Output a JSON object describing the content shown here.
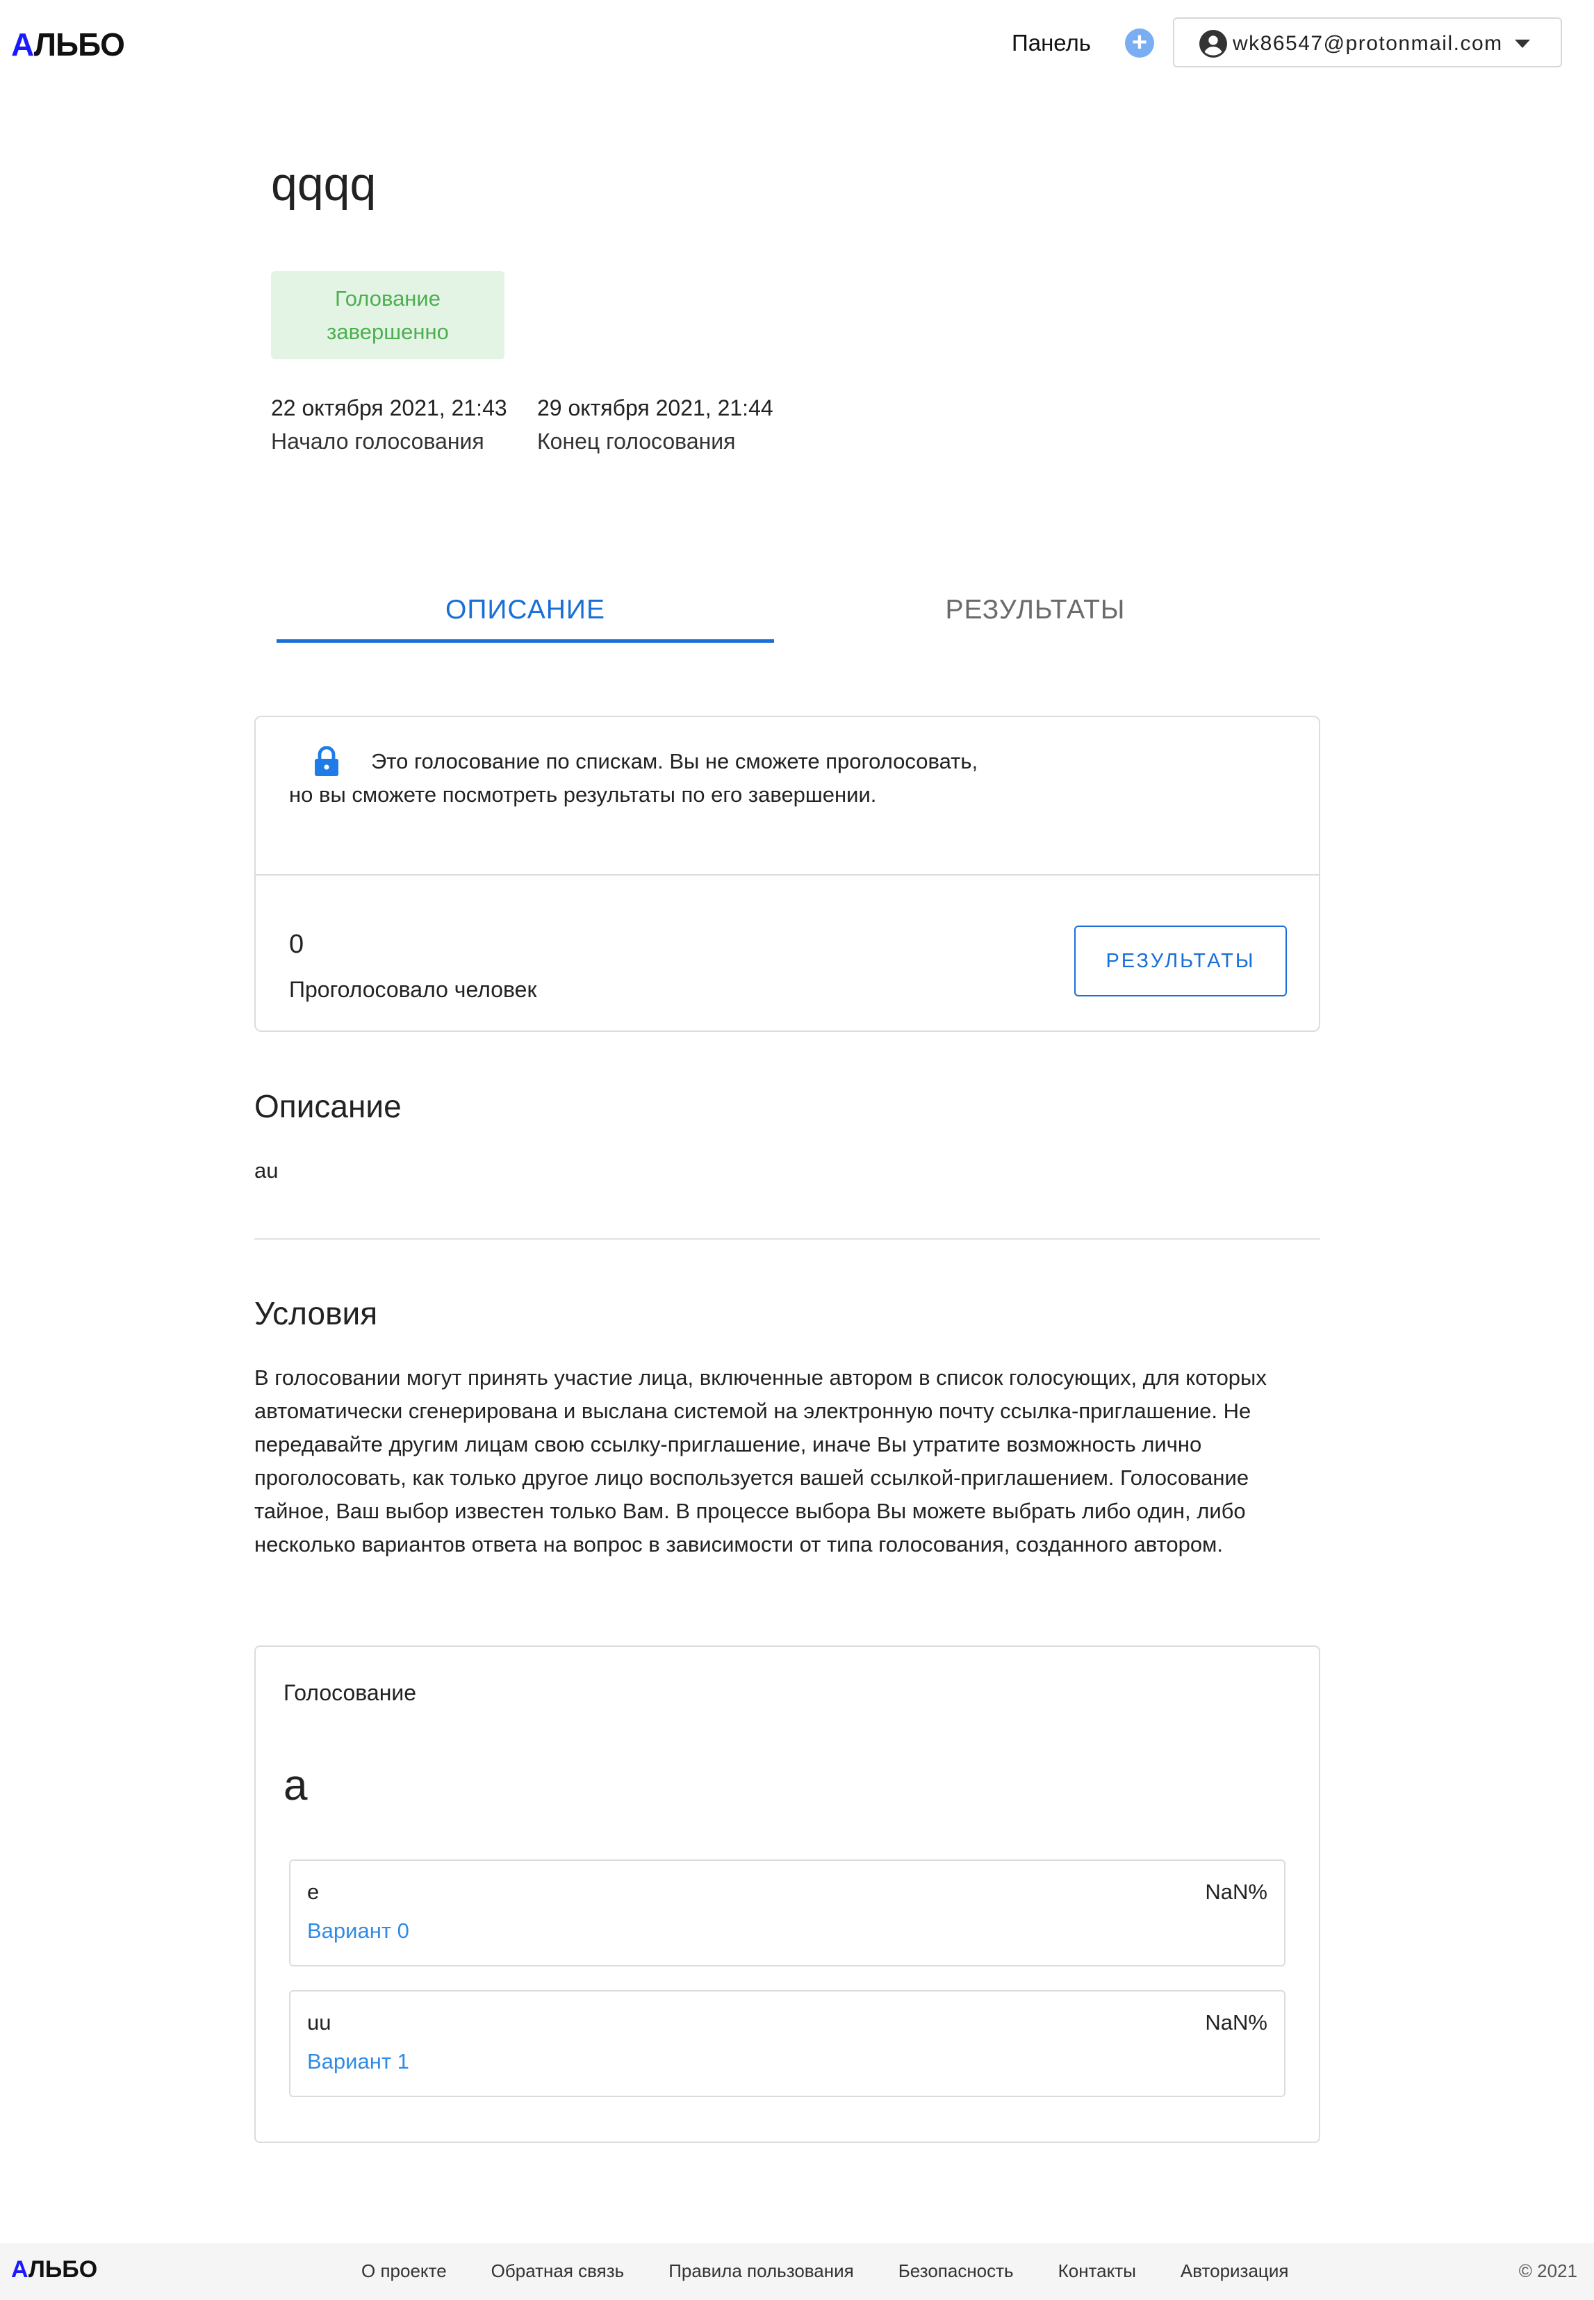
{
  "header": {
    "logo": {
      "first": "А",
      "rest": "ЛЬБО"
    },
    "nav_panel": "Панель",
    "add_icon": "plus-circle-icon",
    "user_email": "wk86547@protonmail.com",
    "user_icon": "account-circle-icon"
  },
  "poll": {
    "title": "qqqq",
    "status": "Голование завершенно",
    "start": {
      "value": "22 октября 2021, 21:43",
      "label": "Начало голосования"
    },
    "end": {
      "value": "29 октября 2021, 21:44",
      "label": "Конец голосования"
    }
  },
  "tabs": [
    {
      "label": "ОПИСАНИЕ",
      "active": true
    },
    {
      "label": "РЕЗУЛЬТАТЫ",
      "active": false
    }
  ],
  "info": {
    "notice": "Это голосование по спискам. Вы не сможете проголосовать, но вы сможете посмотреть результаты по его завершении.",
    "votes_count": "0",
    "votes_label": "Проголосовало человек",
    "results_button": "РЕЗУЛЬТАТЫ"
  },
  "description": {
    "heading": "Описание",
    "text": "au"
  },
  "conditions": {
    "heading": "Условия",
    "text": "В голосовании могут принять участие лица, включенные автором в список голосующих, для которых автоматически сгенерирована и выслана системой на электронную почту ссылка-приглашение. Не передавайте другим лицам свою ссылку-приглашение, иначе Вы утратите возможность лично проголосовать, как только другое лицо воспользуется вашей ссылкой-приглашением. Голосование тайное, Ваш выбор известен только Вам. В процессе выбора Вы можете выбрать либо один, либо несколько вариантов ответа на вопрос в зависимости от типа голосования, созданного автором."
  },
  "voting": {
    "label": "Голосование",
    "question": "a",
    "options": [
      {
        "text": "e",
        "percent": "NaN%",
        "variant": "Вариант 0"
      },
      {
        "text": "uu",
        "percent": "NaN%",
        "variant": "Вариант 1"
      }
    ]
  },
  "footer": {
    "logo": {
      "first": "А",
      "rest": "ЛЬБО"
    },
    "links": [
      "О проекте",
      "Обратная связь",
      "Правила пользования",
      "Безопасность",
      "Контакты",
      "Авторизация"
    ],
    "copyright": "© 2021"
  },
  "colors": {
    "accent": "#1a6fd6",
    "link": "#2f8be6",
    "status_bg": "#e3f3e4",
    "status_text": "#4caf50",
    "logo_accent": "#1a1aff"
  }
}
